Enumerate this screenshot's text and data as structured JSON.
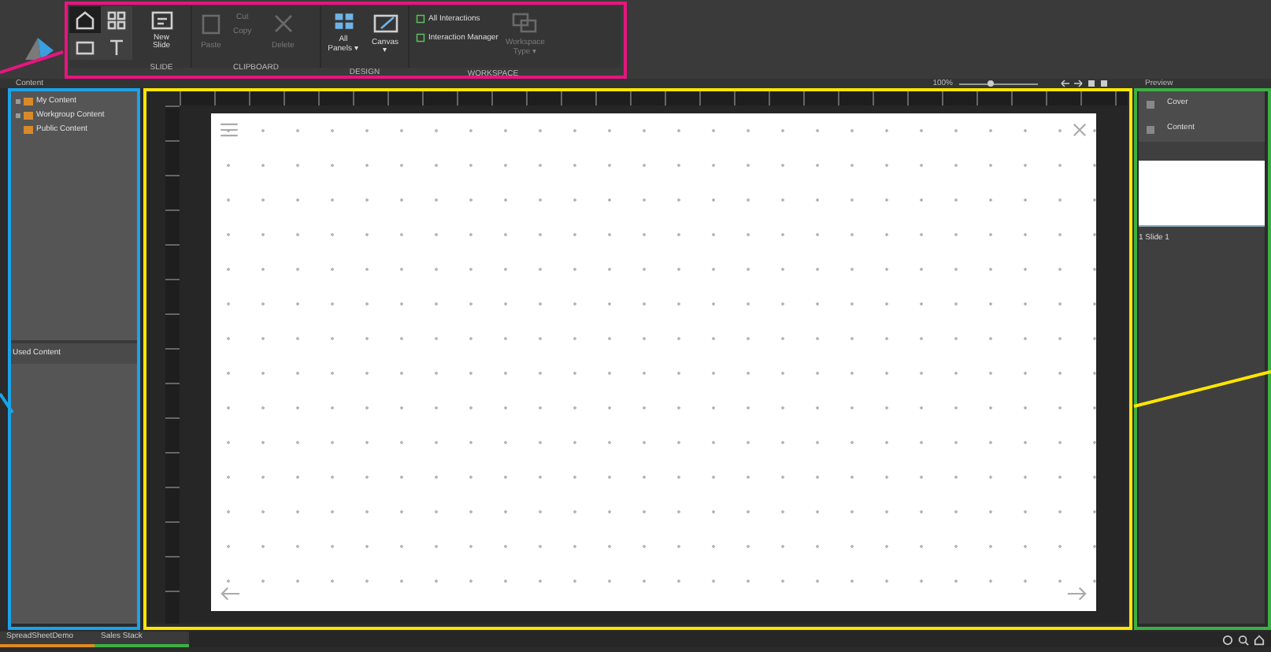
{
  "ribbon": {
    "view_buttons": [
      {
        "selected": true
      },
      {
        "selected": false
      },
      {
        "selected": false
      },
      {
        "selected": false
      }
    ],
    "groups": [
      {
        "label": "SLIDE",
        "items": [
          {
            "label": "New Slide",
            "disabled": false
          }
        ]
      },
      {
        "label": "CLIPBOARD",
        "items": [
          {
            "label": "Paste",
            "disabled": true
          },
          {
            "label": "Cut",
            "disabled": true
          },
          {
            "label": "Copy",
            "disabled": true
          },
          {
            "label": "Delete",
            "disabled": true
          }
        ]
      },
      {
        "label": "DESIGN",
        "items": [
          {
            "label": "All Panels ▾",
            "disabled": false
          },
          {
            "label": "Canvas ▾",
            "disabled": false
          }
        ]
      },
      {
        "label": "WORKSPACE",
        "items": [
          {
            "label": "All Interactions",
            "disabled": false
          },
          {
            "label": "Interaction Manager",
            "disabled": false
          },
          {
            "label": "Workspace Type ▾",
            "disabled": true
          }
        ]
      }
    ]
  },
  "toolbar": {
    "content_label": "Content",
    "zoom": "100%",
    "zoom_slider": {
      "level": 0.4
    },
    "preview_label": "Preview"
  },
  "content_tree": [
    {
      "label": "My Content",
      "expandable": true
    },
    {
      "label": "Workgroup Content",
      "expandable": true
    },
    {
      "label": "Public Content",
      "expandable": false
    }
  ],
  "used_content": {
    "label": "Used Content"
  },
  "pages": [
    {
      "label": "Cover"
    },
    {
      "label": "Content"
    }
  ],
  "slide_thumbnail": {
    "caption": "1 Slide 1"
  },
  "storyboard_tabs": [
    {
      "label": "SpreadSheetDemo",
      "color": "#e08a1e"
    },
    {
      "label": "Sales Stack",
      "color": "#3cb043"
    }
  ]
}
